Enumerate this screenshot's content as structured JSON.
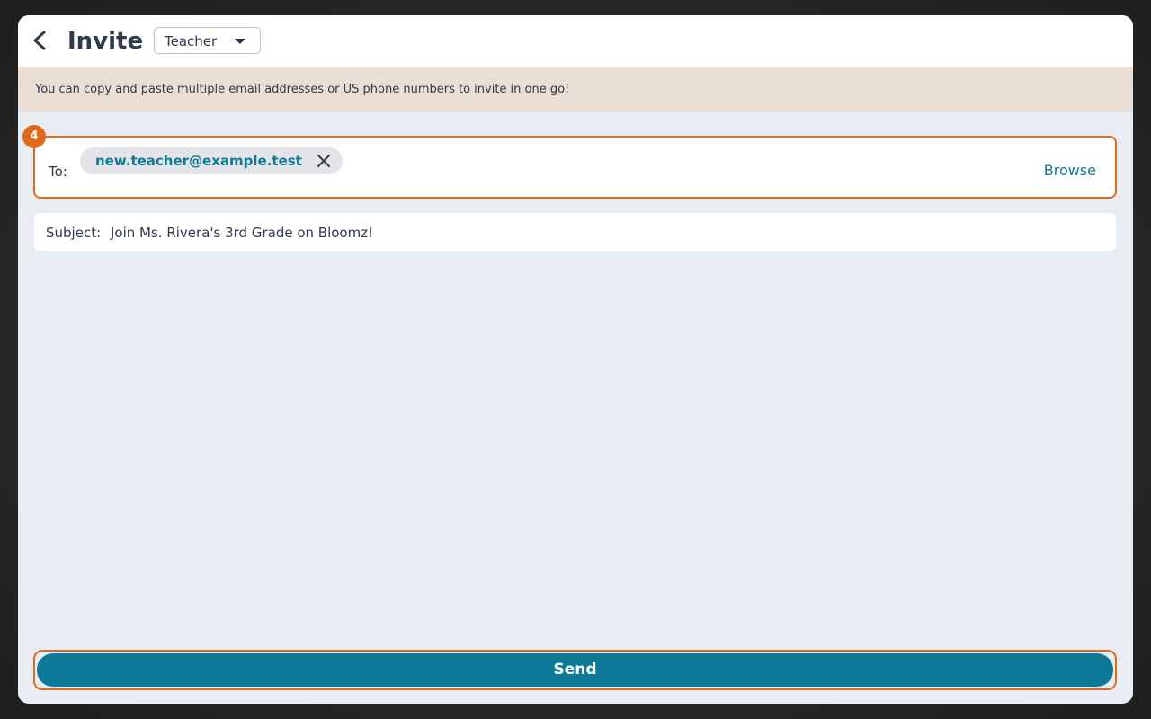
{
  "header": {
    "back_icon": "chevron-left-icon",
    "title": "Invite",
    "role_select": {
      "selected": "Teacher",
      "caret_icon": "caret-down-icon"
    }
  },
  "banner": {
    "text": "You can copy and paste multiple email addresses or US phone numbers to invite in one go!"
  },
  "to_field": {
    "label": "To:",
    "recipients": [
      {
        "value": "new.teacher@example.test",
        "remove_icon": "close-icon"
      }
    ],
    "browse_label": "Browse"
  },
  "step_badge": "4",
  "subject_field": {
    "label": "Subject:",
    "value": "Join Ms. Rivera's 3rd Grade on Bloomz!"
  },
  "send": {
    "label": "Send"
  },
  "colors": {
    "accent_teal": "#0e7a99",
    "highlight_orange": "#e06a1c",
    "banner_bg": "#e9dfd4",
    "page_bg": "#e8ecf3"
  }
}
